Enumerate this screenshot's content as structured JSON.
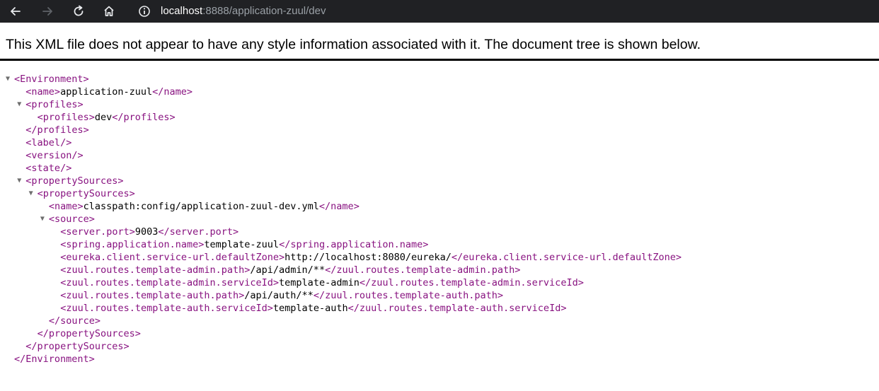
{
  "browser": {
    "url_host": "localhost",
    "url_rest": ":8888/application-zuul/dev",
    "icons": [
      "back-arrow-icon",
      "forward-arrow-icon",
      "reload-icon",
      "home-icon",
      "info-icon"
    ]
  },
  "banner": {
    "text": "This XML file does not appear to have any style information associated with it. The document tree is shown below."
  },
  "xml": {
    "lines": [
      {
        "indent": 1,
        "toggle": true,
        "open": "<Environment>",
        "text": "",
        "close": ""
      },
      {
        "indent": 2,
        "toggle": false,
        "open": "<name>",
        "text": "application-zuul",
        "close": "</name>"
      },
      {
        "indent": 2,
        "toggle": true,
        "open": "<profiles>",
        "text": "",
        "close": ""
      },
      {
        "indent": 3,
        "toggle": false,
        "open": "<profiles>",
        "text": "dev",
        "close": "</profiles>"
      },
      {
        "indent": 2,
        "toggle": false,
        "open": "</profiles>",
        "text": "",
        "close": ""
      },
      {
        "indent": 2,
        "toggle": false,
        "open": "<label/>",
        "text": "",
        "close": ""
      },
      {
        "indent": 2,
        "toggle": false,
        "open": "<version/>",
        "text": "",
        "close": ""
      },
      {
        "indent": 2,
        "toggle": false,
        "open": "<state/>",
        "text": "",
        "close": ""
      },
      {
        "indent": 2,
        "toggle": true,
        "open": "<propertySources>",
        "text": "",
        "close": ""
      },
      {
        "indent": 3,
        "toggle": true,
        "open": "<propertySources>",
        "text": "",
        "close": ""
      },
      {
        "indent": 4,
        "toggle": false,
        "open": "<name>",
        "text": "classpath:config/application-zuul-dev.yml",
        "close": "</name>"
      },
      {
        "indent": 4,
        "toggle": true,
        "open": "<source>",
        "text": "",
        "close": ""
      },
      {
        "indent": 5,
        "toggle": false,
        "open": "<server.port>",
        "text": "9003",
        "close": "</server.port>"
      },
      {
        "indent": 5,
        "toggle": false,
        "open": "<spring.application.name>",
        "text": "template-zuul",
        "close": "</spring.application.name>"
      },
      {
        "indent": 5,
        "toggle": false,
        "open": "<eureka.client.service-url.defaultZone>",
        "text": "http://localhost:8080/eureka/",
        "close": "</eureka.client.service-url.defaultZone>"
      },
      {
        "indent": 5,
        "toggle": false,
        "open": "<zuul.routes.template-admin.path>",
        "text": "/api/admin/**",
        "close": "</zuul.routes.template-admin.path>"
      },
      {
        "indent": 5,
        "toggle": false,
        "open": "<zuul.routes.template-admin.serviceId>",
        "text": "template-admin",
        "close": "</zuul.routes.template-admin.serviceId>"
      },
      {
        "indent": 5,
        "toggle": false,
        "open": "<zuul.routes.template-auth.path>",
        "text": "/api/auth/**",
        "close": "</zuul.routes.template-auth.path>"
      },
      {
        "indent": 5,
        "toggle": false,
        "open": "<zuul.routes.template-auth.serviceId>",
        "text": "template-auth",
        "close": "</zuul.routes.template-auth.serviceId>"
      },
      {
        "indent": 4,
        "toggle": false,
        "open": "</source>",
        "text": "",
        "close": ""
      },
      {
        "indent": 3,
        "toggle": false,
        "open": "</propertySources>",
        "text": "",
        "close": ""
      },
      {
        "indent": 2,
        "toggle": false,
        "open": "</propertySources>",
        "text": "",
        "close": ""
      },
      {
        "indent": 1,
        "toggle": false,
        "open": "</Environment>",
        "text": "",
        "close": ""
      }
    ]
  },
  "colors": {
    "toolbar_bg": "#202124",
    "tag": "#881280",
    "text": "#000000",
    "url_muted": "#9aa0a6"
  }
}
